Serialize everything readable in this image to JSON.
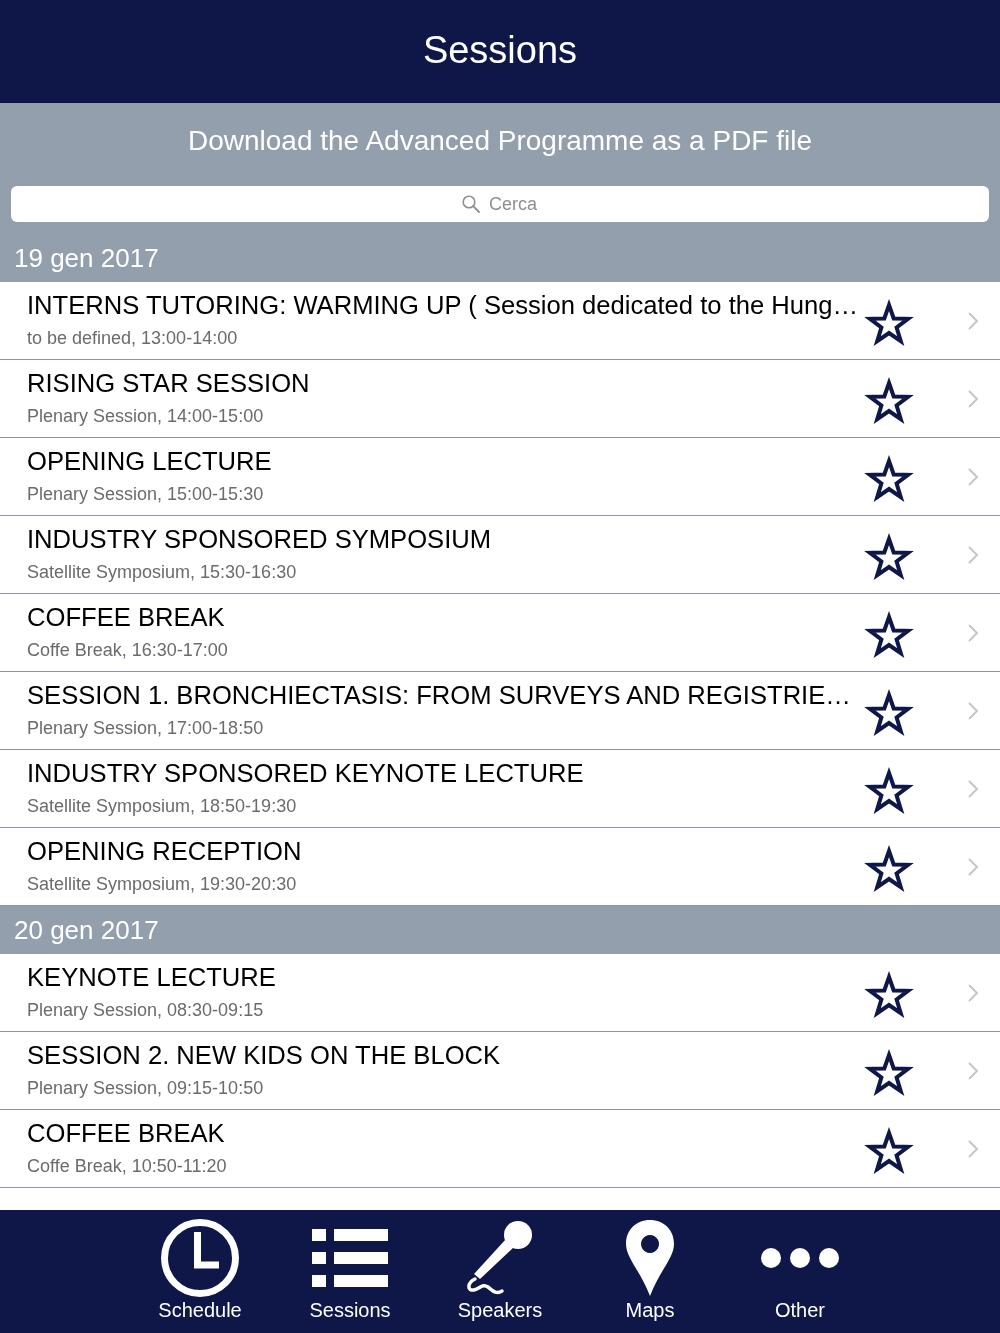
{
  "header": {
    "title": "Sessions"
  },
  "download_link": "Download the Advanced Programme as a PDF file",
  "search": {
    "placeholder": "Cerca"
  },
  "sections": [
    {
      "date": "19 gen 2017",
      "sessions": [
        {
          "title": "INTERNS TUTORING: WARMING UP ( Session dedicated to the Hung…",
          "subtitle": "to be defined, 13:00-14:00",
          "favorite": false
        },
        {
          "title": "RISING STAR SESSION",
          "subtitle": "Plenary Session, 14:00-15:00",
          "favorite": false
        },
        {
          "title": "OPENING LECTURE",
          "subtitle": "Plenary Session, 15:00-15:30",
          "favorite": false
        },
        {
          "title": "INDUSTRY SPONSORED SYMPOSIUM",
          "subtitle": "Satellite Symposium, 15:30-16:30",
          "favorite": false
        },
        {
          "title": "COFFEE BREAK",
          "subtitle": "Coffe Break, 16:30-17:00",
          "favorite": false
        },
        {
          "title": "SESSION 1. BRONCHIECTASIS: FROM SURVEYS AND REGISTRIE…",
          "subtitle": "Plenary Session, 17:00-18:50",
          "favorite": false
        },
        {
          "title": "INDUSTRY SPONSORED KEYNOTE LECTURE",
          "subtitle": "Satellite Symposium, 18:50-19:30",
          "favorite": false
        },
        {
          "title": "OPENING RECEPTION",
          "subtitle": "Satellite Symposium, 19:30-20:30",
          "favorite": false
        }
      ]
    },
    {
      "date": "20 gen 2017",
      "sessions": [
        {
          "title": "KEYNOTE LECTURE",
          "subtitle": "Plenary Session, 08:30-09:15",
          "favorite": false
        },
        {
          "title": "SESSION 2. NEW KIDS ON THE BLOCK",
          "subtitle": "Plenary Session, 09:15-10:50",
          "favorite": false
        },
        {
          "title": "COFFEE BREAK",
          "subtitle": "Coffe Break, 10:50-11:20",
          "favorite": false
        }
      ]
    }
  ],
  "tab_bar": [
    {
      "label": "Schedule",
      "kind": "clock"
    },
    {
      "label": "Sessions",
      "kind": "list"
    },
    {
      "label": "Speakers",
      "kind": "microphone"
    },
    {
      "label": "Maps",
      "kind": "pin"
    },
    {
      "label": "Other",
      "kind": "more"
    }
  ]
}
